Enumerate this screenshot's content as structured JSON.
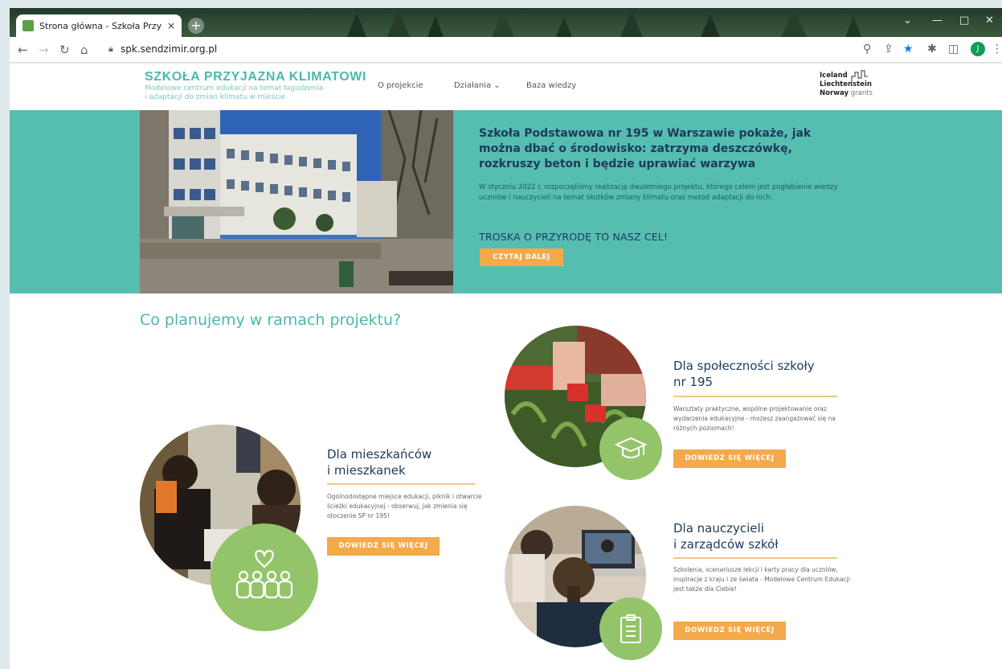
{
  "browser": {
    "tab_title": "Strona główna - Szkoła Przyjazna Klimatowi",
    "tab_close": "×",
    "new_tab": "+",
    "url": "spk.sendzimir.org.pl",
    "profile_initial": "J"
  },
  "site": {
    "brand": {
      "title": "SZKOŁA PRZYJAZNA KLIMATOWI",
      "subtitle_line1": "Modelowe centrum edukacji na temat łagodzenia",
      "subtitle_line2": "i adaptacji do zmian klimatu w mieście"
    },
    "nav": {
      "about": "O projekcie",
      "actions": "Działania ⌄",
      "knowledge": "Baza wiedzy"
    },
    "grants": {
      "line1": "Iceland",
      "line2": "Liechtenstein",
      "line3_bold": "Norway",
      "line3_rest": " grants"
    },
    "hero": {
      "title": "Szkoła Podstawowa nr 195 w Warszawie pokaże, jak można dbać o środowisko: zatrzyma deszczówkę, rozkruszy beton i będzie uprawiać warzywa",
      "text": "W styczniu 2022 r. rozpoczęliśmy realizację dwuletniego projektu, którego celem jest pogłębienie wiedzy uczniów i nauczycieli na temat skutków zmiany klimatu oraz metod adaptacji do nich.",
      "slogan": "TROSKA O PRZYRODĘ TO NASZ CEL!",
      "button": "CZYTAJ DALEJ"
    },
    "section_title": "Co planujemy w ramach projektu?",
    "cards": [
      {
        "title_line1": "Dla społeczności szkoły",
        "title_line2": "nr 195",
        "text": "Warsztaty praktyczne, wspólne projektowanie oraz wydarzenia edukacyjne - możesz zaangażować się na różnych poziomach!",
        "button": "DOWIEDZ SIĘ WIĘCEJ",
        "icon": "graduation-cap-icon"
      },
      {
        "title_line1": "Dla mieszkańców",
        "title_line2": "i mieszkanek",
        "text": "Ogólnodostępne miejsce edukacji, piknik i otwarcie ścieżki edukacyjnej - obserwuj, jak zmienia się otoczenie SP nr 195!",
        "button": "DOWIEDZ SIĘ WIĘCEJ",
        "icon": "community-icon"
      },
      {
        "title_line1": "Dla nauczycieli",
        "title_line2": "i zarządców szkół",
        "text": "Szkolenia, scenariusze lekcji i karty pracy dla uczniów, inspiracje z kraju i ze świata - Modelowe Centrum Edukacji jest także dla Ciebie!",
        "button": "DOWIEDZ SIĘ WIĘCEJ",
        "icon": "clipboard-icon"
      }
    ]
  },
  "colors": {
    "accent_teal": "#56bdb1",
    "accent_orange": "#f4a94a",
    "icon_green": "#94c46a",
    "heading_navy": "#1d3a5a"
  }
}
